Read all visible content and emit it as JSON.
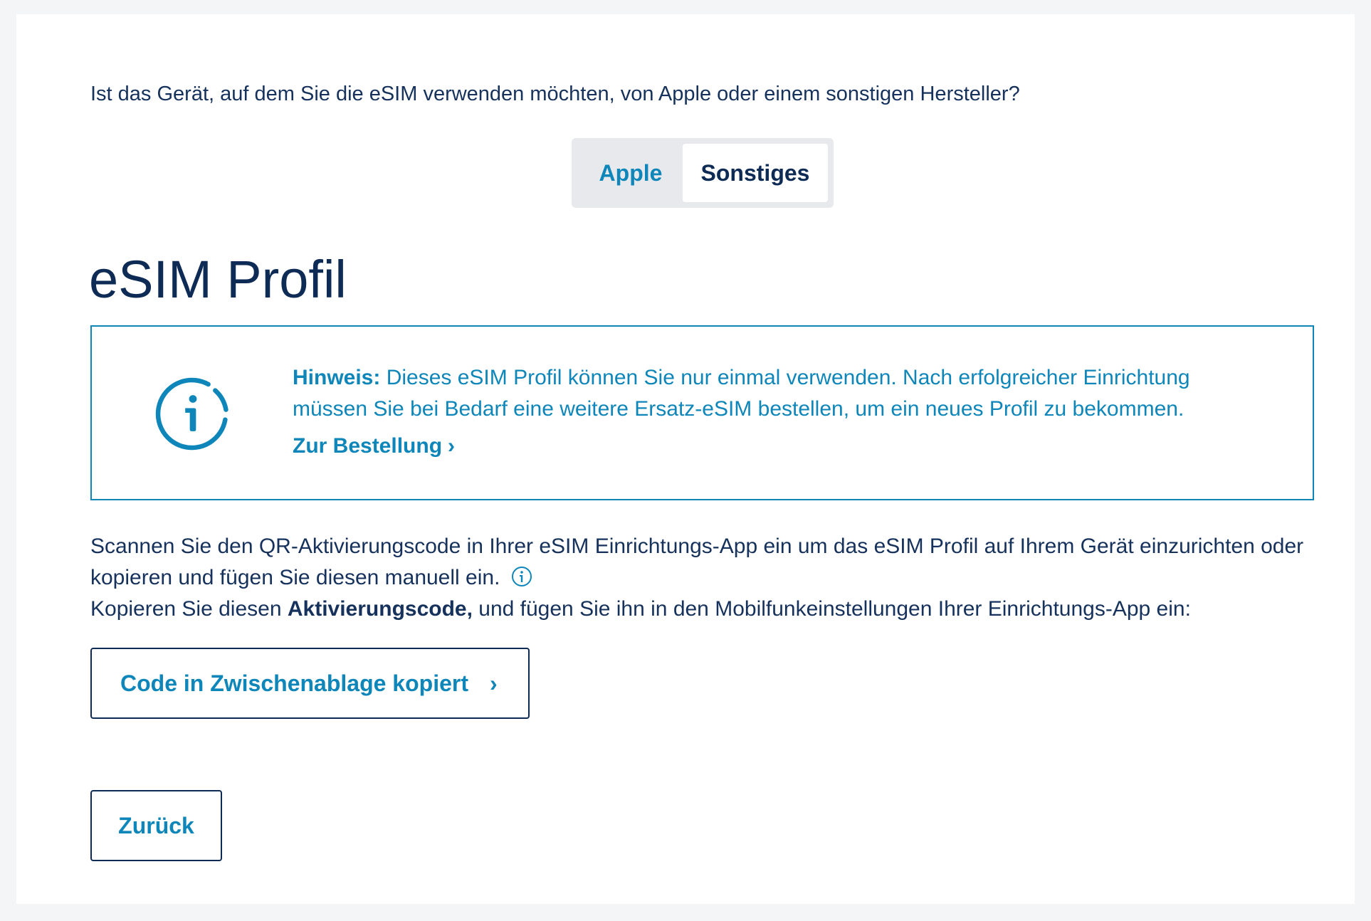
{
  "question": "Ist das Gerät, auf dem Sie die eSIM verwenden möchten, von Apple oder einem sonstigen Hersteller?",
  "toggle": {
    "options": [
      {
        "label": "Apple",
        "selected": false
      },
      {
        "label": "Sonstiges",
        "selected": true
      }
    ]
  },
  "section": {
    "title": "eSIM Profil"
  },
  "notice": {
    "label": "Hinweis:",
    "text": " Dieses eSIM Profil können Sie nur einmal verwenden. Nach erfolgreicher Einrichtung müssen Sie bei Bedarf eine weitere Ersatz-eSIM bestellen, um ein neues Profil zu bekommen.",
    "link_label": "Zur Bestellung",
    "icon": "info-icon"
  },
  "instructions": {
    "line1": "Scannen Sie den QR-Aktivierungscode in Ihrer eSIM Einrichtungs-App ein um das eSIM Profil auf Ihrem Gerät einzurichten oder kopieren und fügen Sie diesen manuell ein.",
    "line2_prefix": "Kopieren Sie diesen ",
    "line2_bold": "Aktivierungscode,",
    "line2_suffix": " und fügen Sie ihn in den Mobilfunkeinstellungen Ihrer Einrichtungs-App ein:"
  },
  "buttons": {
    "copy_label": "Code in Zwischenablage kopiert",
    "back_label": "Zurück"
  },
  "colors": {
    "accent": "#0e86b9",
    "navy": "#0d2b55",
    "background": "#f4f5f7"
  }
}
